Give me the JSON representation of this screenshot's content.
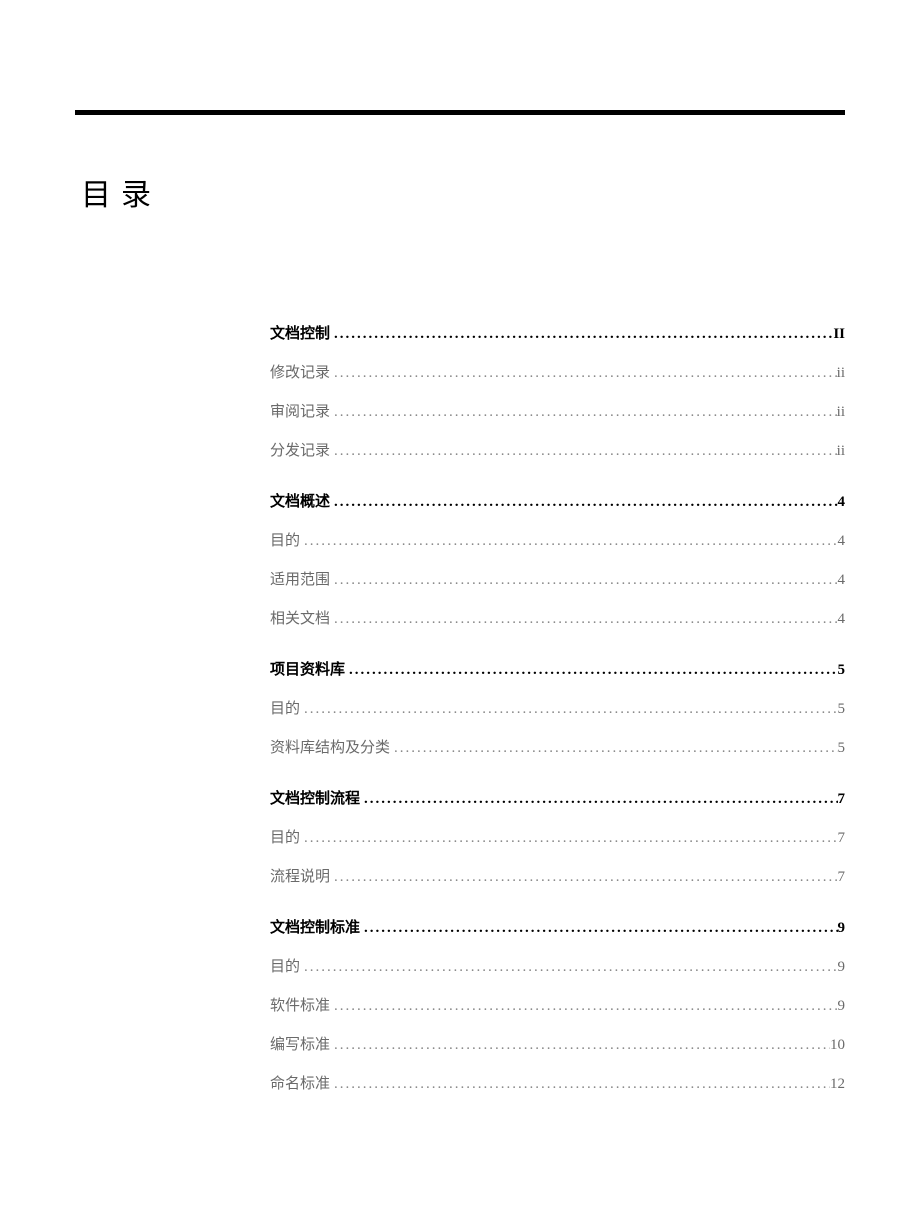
{
  "title": "目录",
  "sections": [
    {
      "heading": {
        "label": "文档控制",
        "page": "II"
      },
      "items": [
        {
          "label": "修改记录",
          "page": "ii"
        },
        {
          "label": "审阅记录",
          "page": "ii"
        },
        {
          "label": "分发记录",
          "page": "ii"
        }
      ]
    },
    {
      "heading": {
        "label": "文档概述",
        "page": "4"
      },
      "items": [
        {
          "label": "目的",
          "page": "4"
        },
        {
          "label": "适用范围",
          "page": "4"
        },
        {
          "label": "相关文档",
          "page": "4"
        }
      ]
    },
    {
      "heading": {
        "label": "项目资料库",
        "page": "5"
      },
      "items": [
        {
          "label": "目的",
          "page": "5"
        },
        {
          "label": "资料库结构及分类",
          "page": "5"
        }
      ]
    },
    {
      "heading": {
        "label": "文档控制流程",
        "page": "7"
      },
      "items": [
        {
          "label": "目的",
          "page": "7"
        },
        {
          "label": "流程说明",
          "page": "7"
        }
      ]
    },
    {
      "heading": {
        "label": "文档控制标准",
        "page": "9"
      },
      "items": [
        {
          "label": "目的",
          "page": "9"
        },
        {
          "label": "软件标准",
          "page": "9"
        },
        {
          "label": "编写标准",
          "page": "10"
        },
        {
          "label": "命名标准",
          "page": "12"
        }
      ]
    }
  ]
}
